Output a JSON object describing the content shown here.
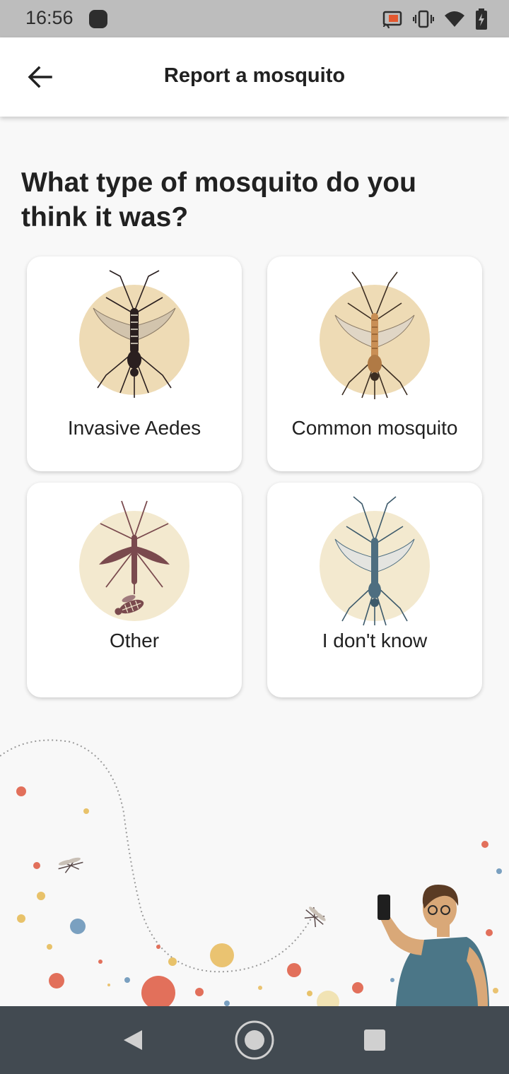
{
  "status_bar": {
    "time": "16:56",
    "icons": [
      "app-notification-icon",
      "cast-icon",
      "vibrate-icon",
      "wifi-icon",
      "battery-charging-icon"
    ]
  },
  "app_bar": {
    "title": "Report a mosquito",
    "back_icon": "arrow-back-icon"
  },
  "question": "What type of mosquito do you think it was?",
  "options": [
    {
      "label": "Invasive Aedes",
      "icon": "aedes-mosquito-icon"
    },
    {
      "label": "Common mosquito",
      "icon": "common-mosquito-icon"
    },
    {
      "label": "Other",
      "icon": "other-insects-icon"
    },
    {
      "label": "I don't know",
      "icon": "unknown-mosquito-icon"
    }
  ],
  "colors": {
    "circle_tan": "#eedbb5",
    "circle_light": "#f3e9cf",
    "aedes_body": "#2a1f1f",
    "common_body": "#b07a45",
    "other_body": "#7a4a4e",
    "unknown_body": "#4e6e80",
    "nav_bar": "#424a51",
    "status_bar": "#bdbdbd"
  },
  "nav_bar": {
    "buttons": [
      "back-triangle-icon",
      "home-circle-icon",
      "recents-square-icon"
    ]
  }
}
